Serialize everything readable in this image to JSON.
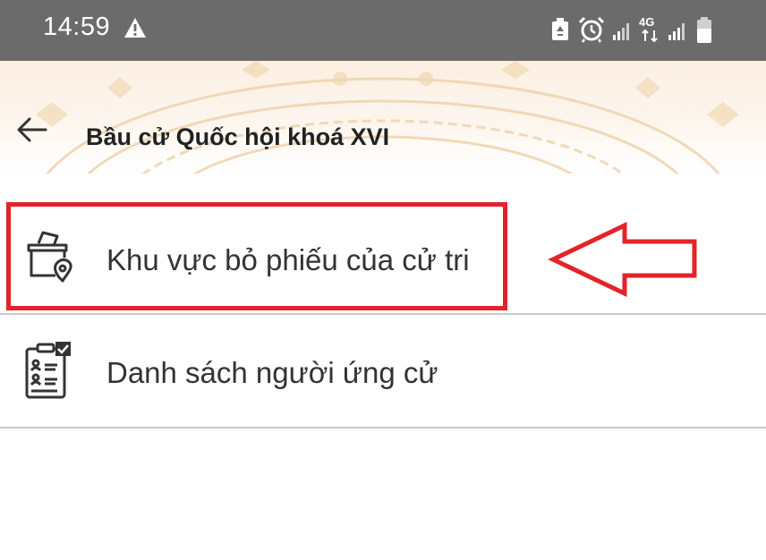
{
  "status_bar": {
    "time": "14:59",
    "icons": [
      "warning-icon",
      "recycle-icon",
      "alarm-icon",
      "signal-icon",
      "network-4g-icon",
      "signal-icon",
      "battery-icon"
    ],
    "network_label": "4G"
  },
  "header": {
    "title": "Bầu cử Quốc hội khoá XVI"
  },
  "menu": {
    "items": [
      {
        "label": "Khu vực bỏ phiếu của cử tri",
        "icon": "ballot-box-location-icon"
      },
      {
        "label": "Danh sách người ứng cử",
        "icon": "candidate-list-icon"
      }
    ]
  },
  "annotation": {
    "highlight_color": "#e2232a"
  },
  "colors": {
    "status_bar": "#6b6b6b",
    "header_tint": "#fbefe1",
    "text": "#333333",
    "divider": "#c9c9c9"
  }
}
